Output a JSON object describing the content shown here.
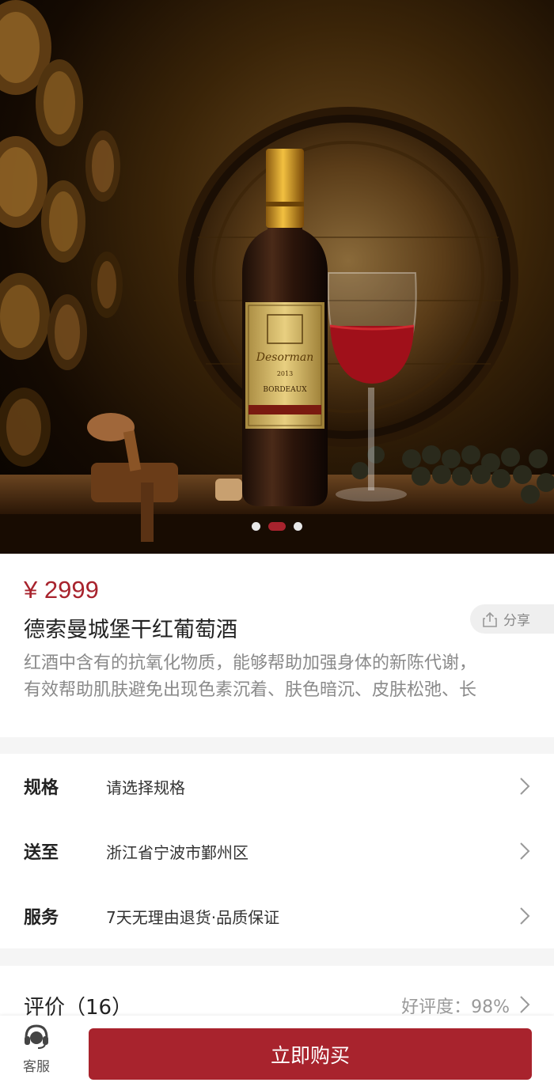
{
  "product": {
    "price": "¥ 2999",
    "title": "德索曼城堡干红葡萄酒",
    "description_lines": [
      "红酒中含有的抗氧化物质，能够帮助加强身体的新陈代谢，",
      "有效帮助肌肤避免出现色素沉着、肤色暗沉、皮肤松弛、长"
    ],
    "share_label": "分享"
  },
  "carousel": {
    "total": 3,
    "active_index": 1
  },
  "hero_label": {
    "brand": "Desorman",
    "year": "2013",
    "region": "BORDEAUX"
  },
  "options": [
    {
      "label": "规格",
      "value": "请选择规格"
    },
    {
      "label": "送至",
      "value": "浙江省宁波市鄞州区"
    },
    {
      "label": "服务",
      "value": "7天无理由退货·品质保证"
    }
  ],
  "review": {
    "title": "评价（16）",
    "rate": "好评度：98%"
  },
  "bottom_bar": {
    "service_label": "客服",
    "buy_label": "立即购买"
  },
  "colors": {
    "accent": "#a8232d",
    "price": "#a8232d"
  },
  "icons": {
    "share": "share-icon",
    "chevron": "chevron-right-icon",
    "service": "headset-icon"
  }
}
